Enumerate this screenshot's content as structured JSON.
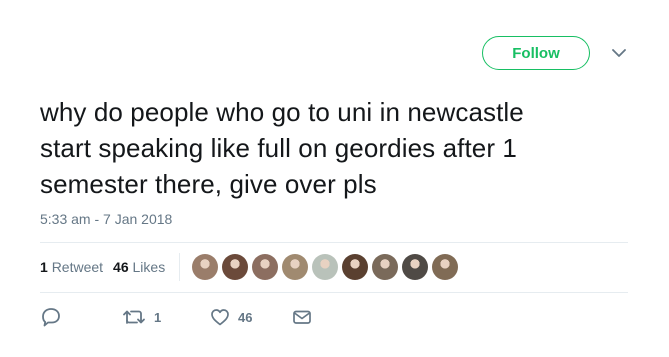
{
  "header": {
    "follow_label": "Follow"
  },
  "tweet": {
    "text_lines": [
      "why do people who go to uni in newcastle",
      "start speaking like full on geordies after 1",
      "semester there, give over pls"
    ],
    "timestamp": "5:33 am - 7 Jan 2018"
  },
  "stats": {
    "retweet_count": "1",
    "retweet_label": "Retweet",
    "like_count": "46",
    "like_label": "Likes",
    "avatars": [
      {
        "name": "liker-avatar",
        "color": "#9a7d6a"
      },
      {
        "name": "liker-avatar",
        "color": "#6b4a3a"
      },
      {
        "name": "liker-avatar",
        "color": "#8c6e60"
      },
      {
        "name": "liker-avatar",
        "color": "#a08a70"
      },
      {
        "name": "liker-avatar",
        "color": "#b9c2ba"
      },
      {
        "name": "liker-avatar",
        "color": "#5a4030"
      },
      {
        "name": "liker-avatar",
        "color": "#7a6a5a"
      },
      {
        "name": "liker-avatar",
        "color": "#4f4a45"
      },
      {
        "name": "liker-avatar",
        "color": "#806b55"
      }
    ]
  },
  "actions": {
    "reply_count": "",
    "retweet_count": "1",
    "like_count": "46"
  },
  "colors": {
    "accent": "#17bf63",
    "muted": "#657786",
    "divider": "#e6ecf0",
    "text": "#14171a"
  }
}
